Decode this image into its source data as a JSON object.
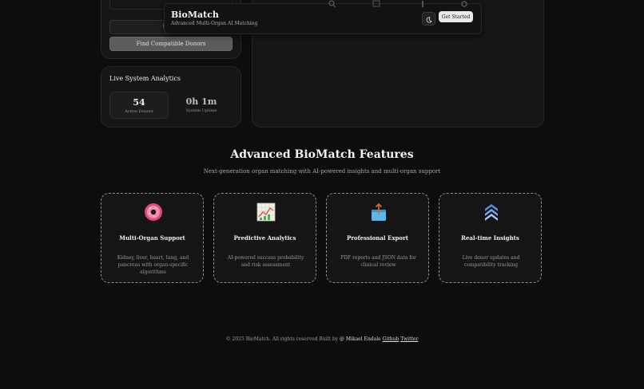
{
  "navbar": {
    "brand_title": "BioMatch",
    "brand_subtitle": "Advanced Multi-Organ AI Matching",
    "theme_icon": "moon-icon",
    "cta_label": "Get Started"
  },
  "left_panel": {
    "use_button_label": "Use S",
    "find_button_label": "Find Compatible Donors"
  },
  "stats": {
    "title": "Live System Analytics",
    "items": [
      {
        "value": "54",
        "label": "Active Donors"
      },
      {
        "value": "0h 1m",
        "label": "System Uptime"
      }
    ]
  },
  "features": {
    "title": "Advanced BioMatch Features",
    "subtitle": "Next-generation organ matching with AI-powered insights and multi-organ support",
    "cards": [
      {
        "icon": "donut-icon",
        "title": "Multi-Organ Support",
        "desc": "Kidney, liver, heart, lung, and pancreas with organ-specific algorithms"
      },
      {
        "icon": "chart-icon",
        "title": "Predictive Analytics",
        "desc": "AI-powered success probability and risk assessment"
      },
      {
        "icon": "export-box-icon",
        "title": "Professional Export",
        "desc": "PDF reports and JSON data for clinical review"
      },
      {
        "icon": "layers-chevron-icon",
        "title": "Real-time Insights",
        "desc": "Live donor updates and compatibility tracking"
      }
    ]
  },
  "footer": {
    "prefix": "© 2025 BioMatch. All rights reserved Built by",
    "author": "@ Mikael Endale",
    "github": "Github",
    "twitter": "Twitter"
  }
}
